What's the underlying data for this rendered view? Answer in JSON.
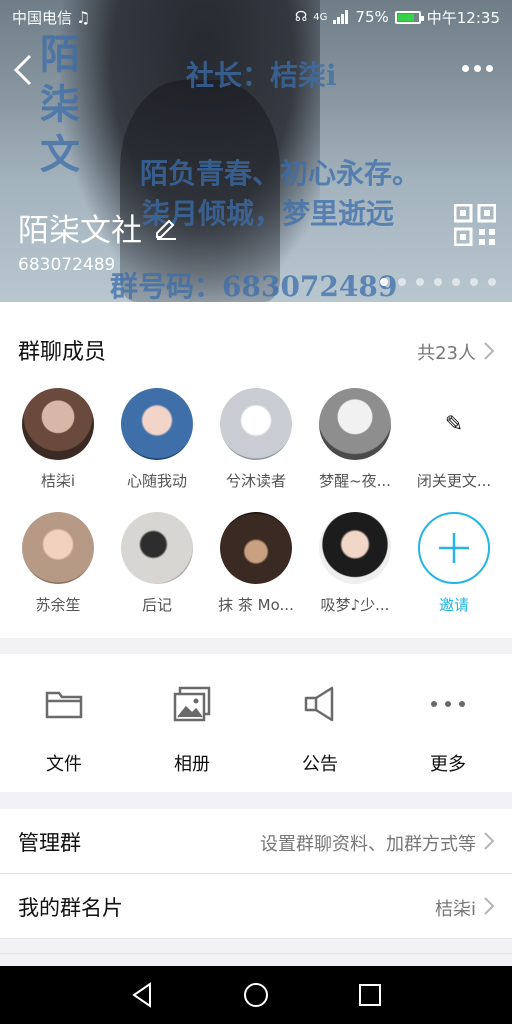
{
  "status_bar": {
    "carrier": "中国电信",
    "signal": "4G",
    "battery": "75%",
    "time": "中午12:35"
  },
  "hero": {
    "bg_line1": "社长：桔柒i",
    "bg_line2": "陌负青春、初心永存。",
    "bg_line3": "柒月倾城，梦里逝远",
    "bg_line4": "群号码：683072489",
    "bg_side": "陌柒文",
    "group_name": "陌柒文社",
    "group_id": "683072489",
    "page_dots": 7,
    "active_dot": 0
  },
  "members": {
    "title": "群聊成员",
    "count": "共23人",
    "list": [
      {
        "name": "桔柒i",
        "color": "#6b4a3e"
      },
      {
        "name": "心随我动",
        "color": "#3f6fa8"
      },
      {
        "name": "兮沐读者",
        "color": "#c9cdd3"
      },
      {
        "name": "梦醒~夜...",
        "color": "#8e8e8e"
      },
      {
        "name": "闭关更文...",
        "color": "#ffffff"
      },
      {
        "name": "苏余笙",
        "color": "#b79a86"
      },
      {
        "name": "后记",
        "color": "#d8d6d2"
      },
      {
        "name": "抹 茶 Mo...",
        "color": "#3b2a24"
      },
      {
        "name": "吸梦♪少...",
        "color": "#efefef"
      }
    ],
    "invite_label": "邀请"
  },
  "tools": [
    {
      "label": "文件",
      "icon": "folder-icon"
    },
    {
      "label": "相册",
      "icon": "album-icon"
    },
    {
      "label": "公告",
      "icon": "megaphone-icon"
    },
    {
      "label": "更多",
      "icon": "more-dots-icon"
    }
  ],
  "settings": {
    "manage_label": "管理群",
    "manage_hint": "设置群聊资料、加群方式等",
    "card_label": "我的群名片",
    "card_value": "桔柒i"
  },
  "colors": {
    "accent": "#24b4e6",
    "battery": "#38d24a"
  }
}
